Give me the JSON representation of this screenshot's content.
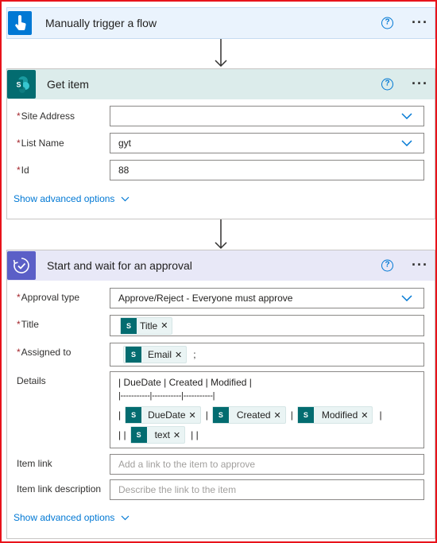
{
  "trigger": {
    "title": "Manually trigger a flow",
    "icon": "touch-icon",
    "color": "#0078d4"
  },
  "get_item": {
    "title": "Get item",
    "icon": "sharepoint-icon",
    "color": "#036c70",
    "fields": {
      "site_address_label": "Site Address",
      "site_address_value": "",
      "list_name_label": "List Name",
      "list_name_value": "gyt",
      "id_label": "Id",
      "id_value": "88"
    },
    "advanced": "Show advanced options"
  },
  "approval": {
    "title": "Start and wait for an approval",
    "icon": "approval-icon",
    "color": "#5b5fc7",
    "fields": {
      "approval_type_label": "Approval type",
      "approval_type_value": "Approve/Reject - Everyone must approve",
      "title_label": "Title",
      "title_token": "Title",
      "assigned_label": "Assigned to",
      "assigned_token": "Email",
      "assigned_suffix": ";",
      "details_label": "Details",
      "details_line1": "| DueDate | Created | Modified |",
      "details_line2": "|-----------|-----------|-----------|",
      "token_duedate": "DueDate",
      "token_created": "Created",
      "token_modified": "Modified",
      "token_text": "text",
      "item_link_label": "Item link",
      "item_link_placeholder": "Add a link to the item to approve",
      "item_link_desc_label": "Item link description",
      "item_link_desc_placeholder": "Describe the link to the item"
    },
    "advanced": "Show advanced options"
  },
  "colors": {
    "accent": "#0078d4",
    "required": "#a4262c",
    "frame": "#e8131b"
  }
}
